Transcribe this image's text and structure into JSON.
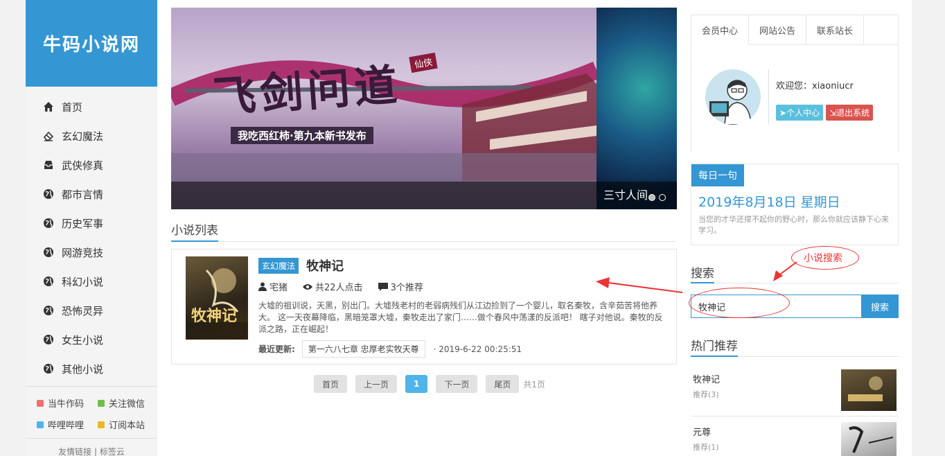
{
  "site": {
    "logo": "牛码小说网"
  },
  "nav": [
    {
      "label": "首页",
      "icon": "home-icon"
    },
    {
      "label": "玄幻魔法",
      "icon": "eraser-icon"
    },
    {
      "label": "武侠修真",
      "icon": "inbox-icon"
    },
    {
      "label": "都市言情",
      "icon": "globe-icon"
    },
    {
      "label": "历史军事",
      "icon": "globe-icon"
    },
    {
      "label": "网游竞技",
      "icon": "globe-icon"
    },
    {
      "label": "科幻小说",
      "icon": "globe-icon"
    },
    {
      "label": "恐怖灵异",
      "icon": "globe-icon"
    },
    {
      "label": "女生小说",
      "icon": "globe-icon"
    },
    {
      "label": "其他小说",
      "icon": "globe-icon"
    }
  ],
  "side_links": [
    {
      "label": "当牛作码",
      "color": "#f07070"
    },
    {
      "label": "关注微信",
      "color": "#6cc04a"
    },
    {
      "label": "哔哩哔哩",
      "color": "#4fb4ea"
    },
    {
      "label": "订阅本站",
      "color": "#f0b429"
    }
  ],
  "side_footer": "友情链接 | 标签云",
  "carousel": {
    "main_title": "飞剑问道",
    "main_tag": "仙侠",
    "main_sub": "我吃西红柿·第九本新书发布",
    "caption": "三寸人间"
  },
  "novel_list": {
    "title": "小说列表",
    "items": [
      {
        "category": "玄幻魔法",
        "name": "牧神记",
        "author": "宅猪",
        "clicks": "共22人点击",
        "recommend": "3个推荐",
        "description": "大墟的祖训说，天黑，别出门。大墟残老村的老弱病残们从江边捡到了一个婴儿，取名秦牧，含辛茹苦将他养大。 这一天夜幕降临，黑暗笼罩大墟，秦牧走出了家门……做个春风中荡漾的反派吧！ 瞎子对他说。秦牧的反派之路，正在崛起！",
        "latest_label": "最近更新:",
        "latest_chapter": "第一六八七章 忠厚老实牧天尊",
        "latest_time": "· 2019-6-22 00:25:51",
        "cover_text": "牧神记"
      }
    ]
  },
  "pagination": {
    "first": "首页",
    "prev": "上一页",
    "current": "1",
    "next": "下一页",
    "last": "尾页",
    "total": "共1页"
  },
  "member": {
    "tabs": [
      "会员中心",
      "网站公告",
      "联系站长"
    ],
    "welcome": "欢迎您：xiaoniucr",
    "personal_btn": "个人中心",
    "logout_btn": "退出系统"
  },
  "daily": {
    "tag": "每日一句",
    "date": "2019年8月18日 星期日",
    "quote": "当您的才华还撑不起你的野心时，那么你就应该静下心来学习。"
  },
  "search": {
    "title": "搜索",
    "value": "牧神记",
    "button": "搜索",
    "annotation": "小说搜索"
  },
  "hot": {
    "title": "热门推荐",
    "items": [
      {
        "name": "牧神记",
        "recommend": "推荐(3)"
      },
      {
        "name": "元尊",
        "recommend": "推荐(1)"
      }
    ]
  },
  "colors": {
    "accent": "#3497d3",
    "annotation": "#ee3333"
  }
}
